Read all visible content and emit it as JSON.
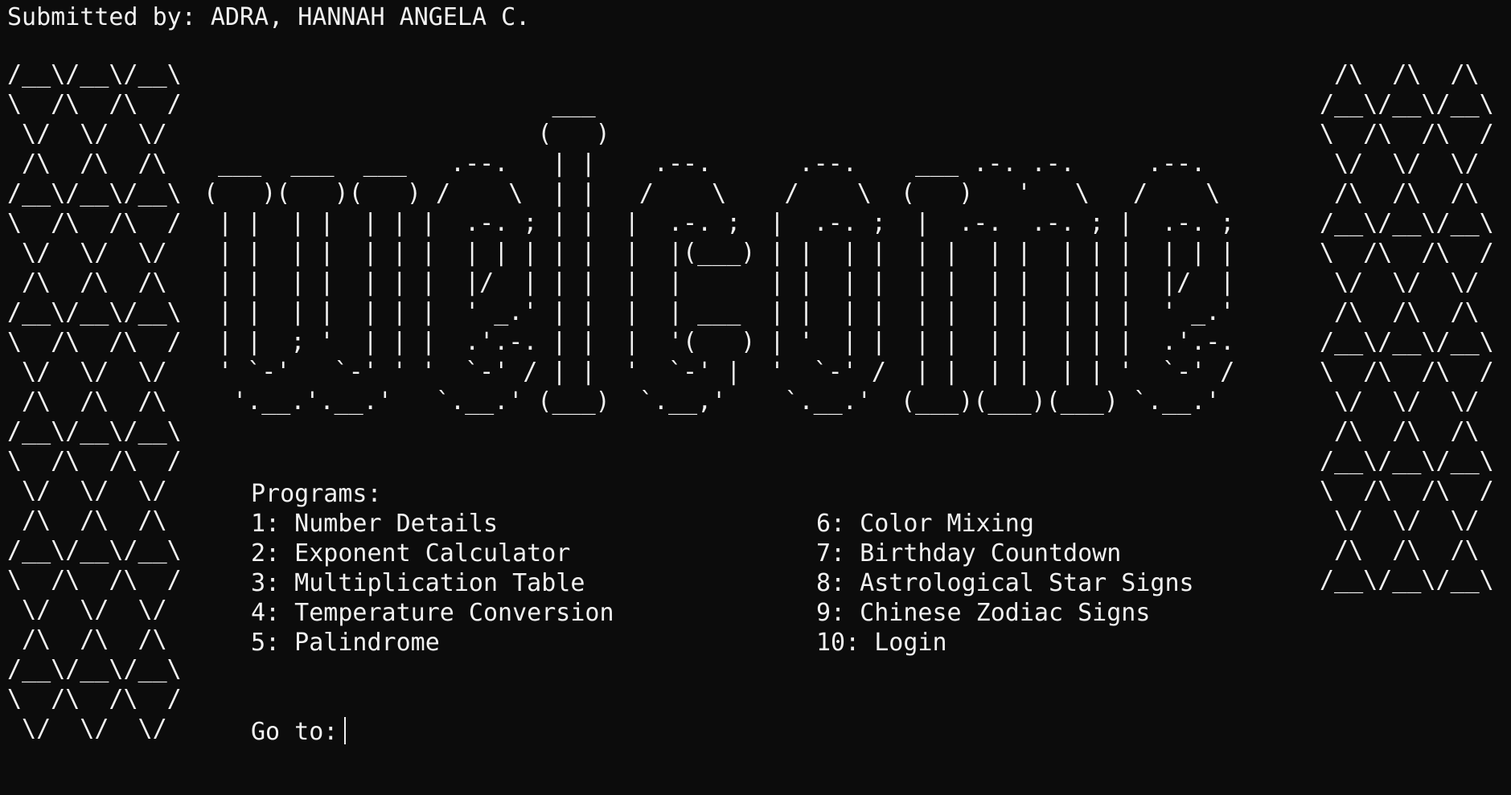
{
  "header": {
    "submitted_by": "Submitted by: ADRA, HANNAH ANGELA C."
  },
  "decor": {
    "left_pattern": "/__\\/__\\/__\\\n\\  /\\  /\\  /\n \\/  \\/  \\/\n /\\  /\\  /\\\n/__\\/__\\/__\\\n\\  /\\  /\\  /\n \\/  \\/  \\/\n /\\  /\\  /\\\n/__\\/__\\/__\\\n\\  /\\  /\\  /\n \\/  \\/  \\/\n /\\  /\\  /\\\n/__\\/__\\/__\\\n\\  /\\  /\\  /\n \\/  \\/  \\/\n /\\  /\\  /\\\n/__\\/__\\/__\\\n\\  /\\  /\\  /\n \\/  \\/  \\/\n /\\  /\\  /\\\n/__\\/__\\/__\\\n\\  /\\  /\\  /\n \\/  \\/  \\/",
    "right_pattern": " /\\  /\\  /\\\n/__\\/__\\/__\\\n\\  /\\  /\\  /\n \\/  \\/  \\/\n /\\  /\\  /\\\n/__\\/__\\/__\\\n\\  /\\  /\\  /\n \\/  \\/  \\/\n /\\  /\\  /\\\n/__\\/__\\/__\\\n\\  /\\  /\\  /\n \\/  \\/  \\/\n /\\  /\\  /\\\n/__\\/__\\/__\\\n\\  /\\  /\\  /\n \\/  \\/  \\/\n /\\  /\\  /\\\n/__\\/__\\/__\\",
    "welcome_banner": "                        ___\n                       (   )\n ___  ___  ___   .--.   | |    .--.      .--.    ___ .-. .-.     .--.\n(   )(   )(   ) /    \\  | |   /    \\    /    \\  (   )   '   \\   /    \\\n | |  | |  | | |  .-. ; | |  |  .-. ;  |  .-. ;  |  .-.  .-. ; |  .-. ;\n | |  | |  | | |  | | | | |  |  |(___) | |  | |  | |  | |  | | |  | | |\n | |  | |  | | |  |/  | | |  |  |      | |  | |  | |  | |  | | |  |/  |\n | |  | |  | | |  ' _.' | |  |  | ___  | |  | |  | |  | |  | | |  ' _.'\n | |  ; '  | | |  .'.-. | |  |  '(   ) | '  | |  | |  | |  | | |  .'.-.\n ' `-'   `-' ' '  `-' / | |  '  `-' |  '  `-' /  | |  | |  | | '  `-' /\n  '.__.'.__.'   `.__.' (___)  `.__,'    `.__.'  (___)(___)(___) `.__.'"
  },
  "menu": {
    "heading": "Programs:",
    "left_items": [
      "1: Number Details",
      "2: Exponent Calculator",
      "3: Multiplication Table",
      "4: Temperature Conversion",
      "5: Palindrome"
    ],
    "right_items": [
      "6: Color Mixing",
      "7: Birthday Countdown",
      "8: Astrological Star Signs",
      "9: Chinese Zodiac Signs",
      "10: Login"
    ]
  },
  "prompt": {
    "label": "Go to:"
  },
  "colors": {
    "background": "#0c0c0c",
    "foreground": "#f2f2f2"
  }
}
